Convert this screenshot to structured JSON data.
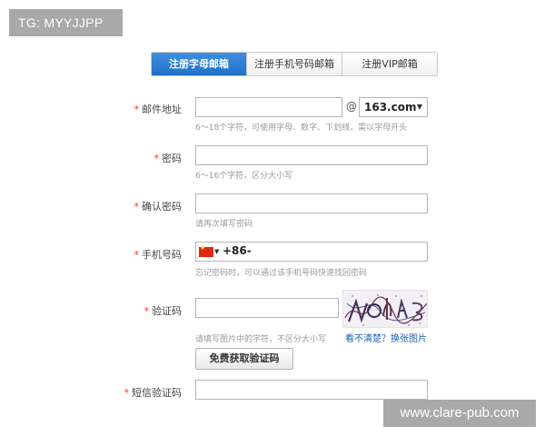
{
  "watermarks": {
    "top": "TG: MYYJJPP",
    "bottom": "www.clare-pub.com"
  },
  "tabs": [
    {
      "label": "注册字母邮箱",
      "active": true
    },
    {
      "label": "注册手机号码邮箱",
      "active": false
    },
    {
      "label": "注册VIP邮箱",
      "active": false
    }
  ],
  "required_mark": "*",
  "form": {
    "email": {
      "label": "邮件地址",
      "at": "@",
      "domain": "163.com",
      "hint": "6～18个字符，可使用字母、数字、下划线，需以字母开头"
    },
    "password": {
      "label": "密码",
      "hint": "6～16个字符，区分大小写"
    },
    "confirm": {
      "label": "确认密码",
      "hint": "请再次填写密码"
    },
    "phone": {
      "label": "手机号码",
      "code": "+86-",
      "hint": "忘记密码时，可以通过该手机号码快速找回密码"
    },
    "captcha": {
      "label": "验证码",
      "hint": "请填写图片中的字符，不区分大小写",
      "refresh": "看不清楚？换张图片"
    },
    "sms_button": "免费获取验证码",
    "sms": {
      "label": "短信验证码"
    }
  },
  "colors": {
    "tab_active": "#2a7fd8",
    "required": "#e33333",
    "link": "#1f5fb0"
  },
  "icons": {
    "flag": "china-flag-icon",
    "select": "chevron-down-icon"
  }
}
